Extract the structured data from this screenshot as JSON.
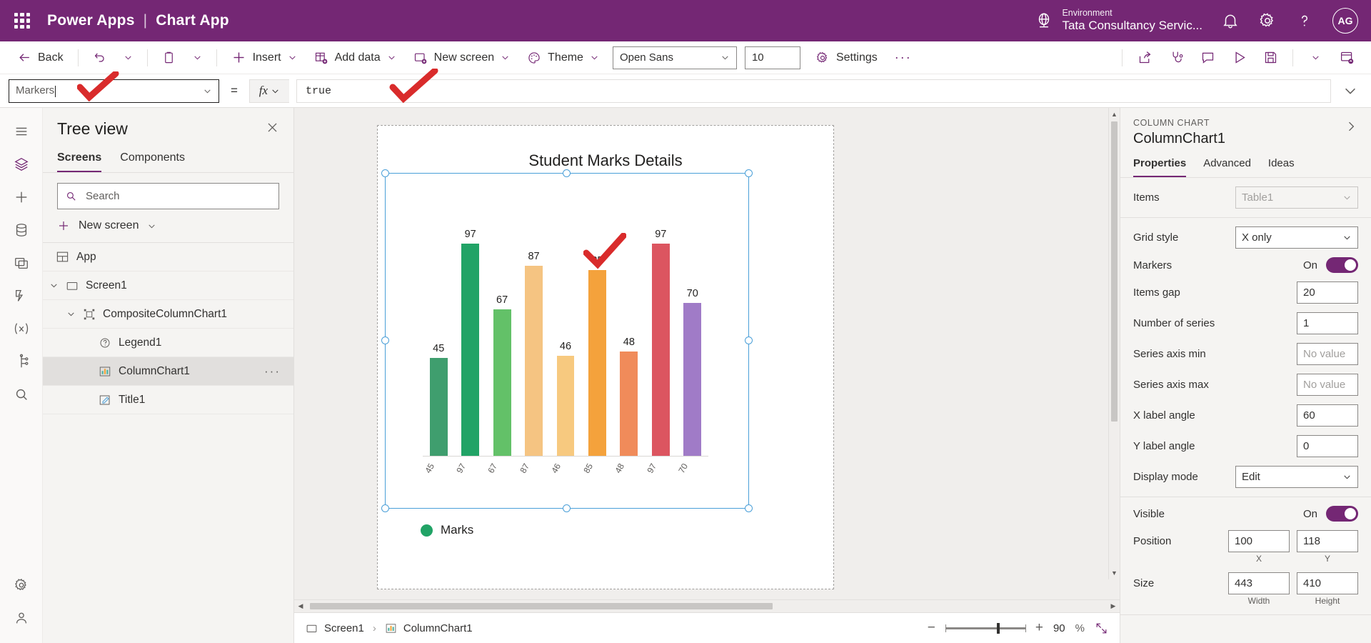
{
  "topbar": {
    "waffle_title": "App launcher",
    "product": "Power Apps",
    "separator": "|",
    "app_name": "Chart App",
    "environment_label": "Environment",
    "environment_name": "Tata Consultancy Servic...",
    "avatar_initials": "AG",
    "accent": "#742774"
  },
  "commandbar": {
    "back": "Back",
    "insert": "Insert",
    "add_data": "Add data",
    "new_screen": "New screen",
    "theme": "Theme",
    "font_family": "Open Sans",
    "font_size": "10",
    "settings": "Settings",
    "more": "···"
  },
  "formulabar": {
    "property": "Markers",
    "equals": "=",
    "fx": "fx",
    "formula": "true"
  },
  "treeview": {
    "title": "Tree view",
    "tabs": [
      {
        "label": "Screens",
        "active": true
      },
      {
        "label": "Components",
        "active": false
      }
    ],
    "search_placeholder": "Search",
    "search_value": "",
    "new_screen": "New screen",
    "items": [
      {
        "label": "App",
        "icon": "app-icon",
        "indent": 1,
        "expander": "",
        "selected": false
      },
      {
        "label": "Screen1",
        "icon": "screen-icon",
        "indent": 1,
        "expander": "v",
        "selected": false
      },
      {
        "label": "CompositeColumnChart1",
        "icon": "group-icon",
        "indent": 2,
        "expander": "v",
        "selected": false
      },
      {
        "label": "Legend1",
        "icon": "legend-icon",
        "indent": 3,
        "expander": "",
        "selected": false
      },
      {
        "label": "ColumnChart1",
        "icon": "chart-icon",
        "indent": 3,
        "expander": "",
        "selected": true
      },
      {
        "label": "Title1",
        "icon": "label-icon",
        "indent": 3,
        "expander": "",
        "selected": false
      }
    ]
  },
  "chart_data": {
    "type": "bar",
    "title": "Student Marks Details",
    "categories": [
      "45",
      "97",
      "67",
      "87",
      "46",
      "85",
      "48",
      "97",
      "70"
    ],
    "values": [
      45,
      97,
      67,
      87,
      46,
      85,
      48,
      97,
      70
    ],
    "series": [
      {
        "name": "Marks",
        "values": [
          45,
          97,
          67,
          87,
          46,
          85,
          48,
          97,
          70
        ]
      }
    ],
    "colors": [
      "#3f9e6e",
      "#21a366",
      "#63c168",
      "#f5c482",
      "#f7c97f",
      "#f4a23c",
      "#f08b5a",
      "#dc5560",
      "#a07bc7"
    ],
    "legend": [
      {
        "label": "Marks",
        "color": "#21a366"
      }
    ],
    "xlabel": "",
    "ylabel": "",
    "ylim": [
      0,
      110
    ],
    "grid": "X only",
    "x_label_angle": 60,
    "legend_position": "bottom-left",
    "data_labels": true
  },
  "statusbar": {
    "screen": "Screen1",
    "separator": "›",
    "control": "ColumnChart1",
    "zoom_out": "−",
    "zoom_in": "+",
    "zoom_value": "90",
    "zoom_unit": "%"
  },
  "properties": {
    "kicker": "COLUMN CHART",
    "name": "ColumnChart1",
    "tabs": [
      {
        "label": "Properties",
        "active": true
      },
      {
        "label": "Advanced",
        "active": false
      },
      {
        "label": "Ideas",
        "active": false
      }
    ],
    "rows": [
      {
        "label": "Items",
        "type": "select-disabled",
        "value": "Table1"
      },
      {
        "label": "Grid style",
        "type": "select",
        "value": "X only"
      },
      {
        "label": "Markers",
        "type": "toggle",
        "value": "On"
      },
      {
        "label": "Items gap",
        "type": "input",
        "value": "20"
      },
      {
        "label": "Number of series",
        "type": "input",
        "value": "1"
      },
      {
        "label": "Series axis min",
        "type": "input-placeholder",
        "value": "No value"
      },
      {
        "label": "Series axis max",
        "type": "input-placeholder",
        "value": "No value"
      },
      {
        "label": "X label angle",
        "type": "input",
        "value": "60"
      },
      {
        "label": "Y label angle",
        "type": "input",
        "value": "0"
      },
      {
        "label": "Display mode",
        "type": "select",
        "value": "Edit"
      },
      {
        "label": "Visible",
        "type": "toggle",
        "value": "On"
      }
    ],
    "position": {
      "label": "Position",
      "x": "100",
      "y": "118",
      "x_caption": "X",
      "y_caption": "Y"
    },
    "size": {
      "label": "Size",
      "width": "443",
      "height": "410",
      "w_caption": "Width",
      "h_caption": "Height"
    }
  }
}
